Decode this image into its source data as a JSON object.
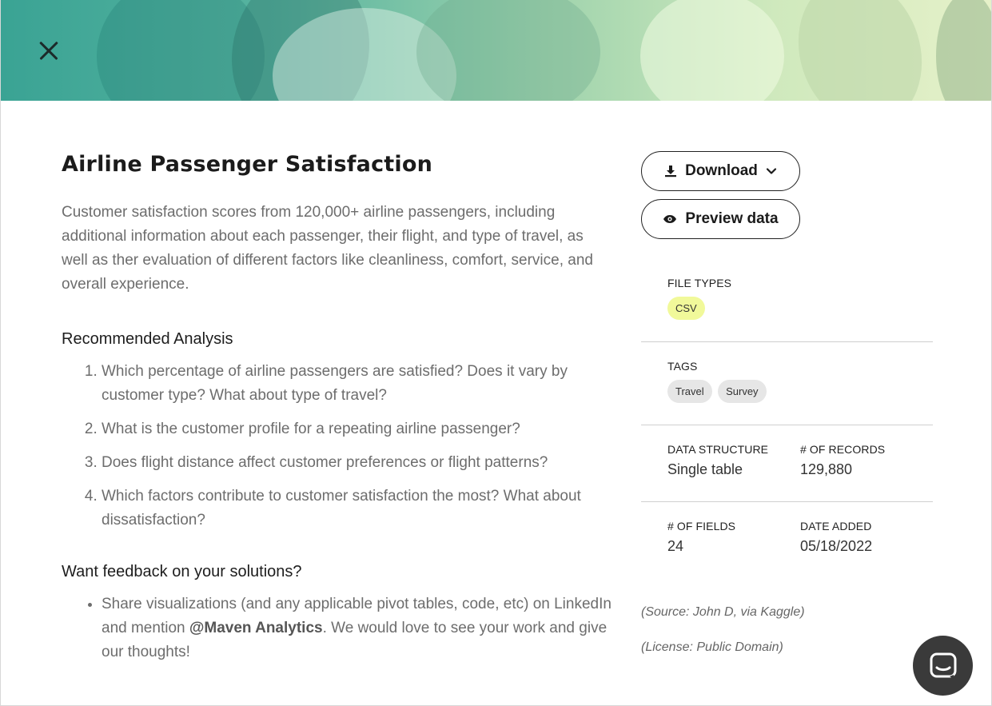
{
  "header": {
    "close_icon": "close-icon"
  },
  "dataset": {
    "title": "Airline Passenger Satisfaction",
    "description": "Customer satisfaction scores from 120,000+ airline passengers, including additional information about each passenger, their flight, and type of travel, as well as ther evaluation of different factors like cleanliness, comfort, service, and overall experience."
  },
  "recommended": {
    "heading": "Recommended Analysis",
    "items": [
      "Which percentage of airline passengers are satisfied? Does it vary by customer type? What about type of travel?",
      "What is the customer profile for a repeating airline passenger?",
      "Does flight distance affect customer preferences or flight patterns?",
      "Which factors contribute to customer satisfaction the most? What about dissatisfaction?"
    ]
  },
  "feedback": {
    "heading": "Want feedback on your solutions?",
    "text_before": "Share visualizations (and any applicable pivot tables, code, etc) on LinkedIn and mention ",
    "mention": "@Maven Analytics",
    "text_after": ". We would love to see your work and give our thoughts!"
  },
  "actions": {
    "download_label": "Download",
    "download_icon": "download-icon",
    "chevron_icon": "chevron-down-icon",
    "preview_label": "Preview data",
    "preview_icon": "eye-icon"
  },
  "meta": {
    "file_types_label": "FILE TYPES",
    "file_types": [
      "CSV"
    ],
    "tags_label": "TAGS",
    "tags": [
      "Travel",
      "Survey"
    ],
    "data_structure_label": "DATA STRUCTURE",
    "data_structure": "Single table",
    "records_label": "# OF RECORDS",
    "records": "129,880",
    "fields_label": "# OF FIELDS",
    "fields": "24",
    "date_added_label": "DATE ADDED",
    "date_added": "05/18/2022"
  },
  "source": {
    "source_text": "(Source: John D, via Kaggle)",
    "license_text": "(License: Public Domain)"
  },
  "chat": {
    "icon": "chat-icon"
  },
  "colors": {
    "csv_pill": "#f1f99a",
    "tag_pill": "#e6e6e6",
    "chat_button": "#3a3a3a",
    "banner_start": "#3aa394",
    "banner_end": "#e6f1c9"
  }
}
